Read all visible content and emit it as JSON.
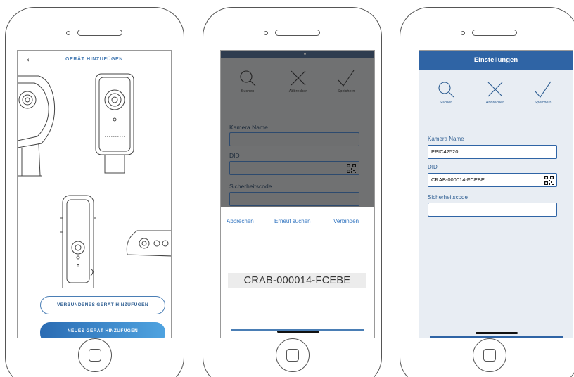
{
  "screen1": {
    "header": {
      "back_glyph": "←",
      "title": "GERÄT HINZUFÜGEN"
    },
    "buttons": {
      "connected_device": "VERBUNDENES GERÄT HINZUFÜGEN",
      "new_device": "NEUES GERÄT HINZUFÜGEN"
    }
  },
  "screen2": {
    "toolbar": {
      "search": "Suchen",
      "cancel": "Abbrechen",
      "save": "Speichern"
    },
    "form": {
      "camera_name_label": "Kamera Name",
      "did_label": "DID",
      "security_code_label": "Sicherheitscode"
    },
    "sheet": {
      "cancel": "Abbrechen",
      "search_again": "Erneut suchen",
      "connect": "Verbinden",
      "found_code": "CRAB-000014-FCEBE"
    }
  },
  "screen3": {
    "header": {
      "title": "Einstellungen"
    },
    "toolbar": {
      "search": "Suchen",
      "cancel": "Abbrechen",
      "save": "Speichern"
    },
    "form": {
      "camera_name_label": "Kamera Name",
      "camera_name_value": "PPIC42520",
      "did_label": "DID",
      "did_value": "CRAB-000014-FCEBE",
      "security_code_label": "Sicherheitscode",
      "security_code_value": ""
    }
  },
  "icons": [
    "back-arrow-icon",
    "search-icon",
    "close-icon",
    "checkmark-icon",
    "qr-code-icon"
  ],
  "colors": {
    "accent_blue": "#2f64a5",
    "link_blue": "#2e72bf",
    "dim_overlay": "#707172",
    "button_gradient_end": "#4fa3e0"
  }
}
